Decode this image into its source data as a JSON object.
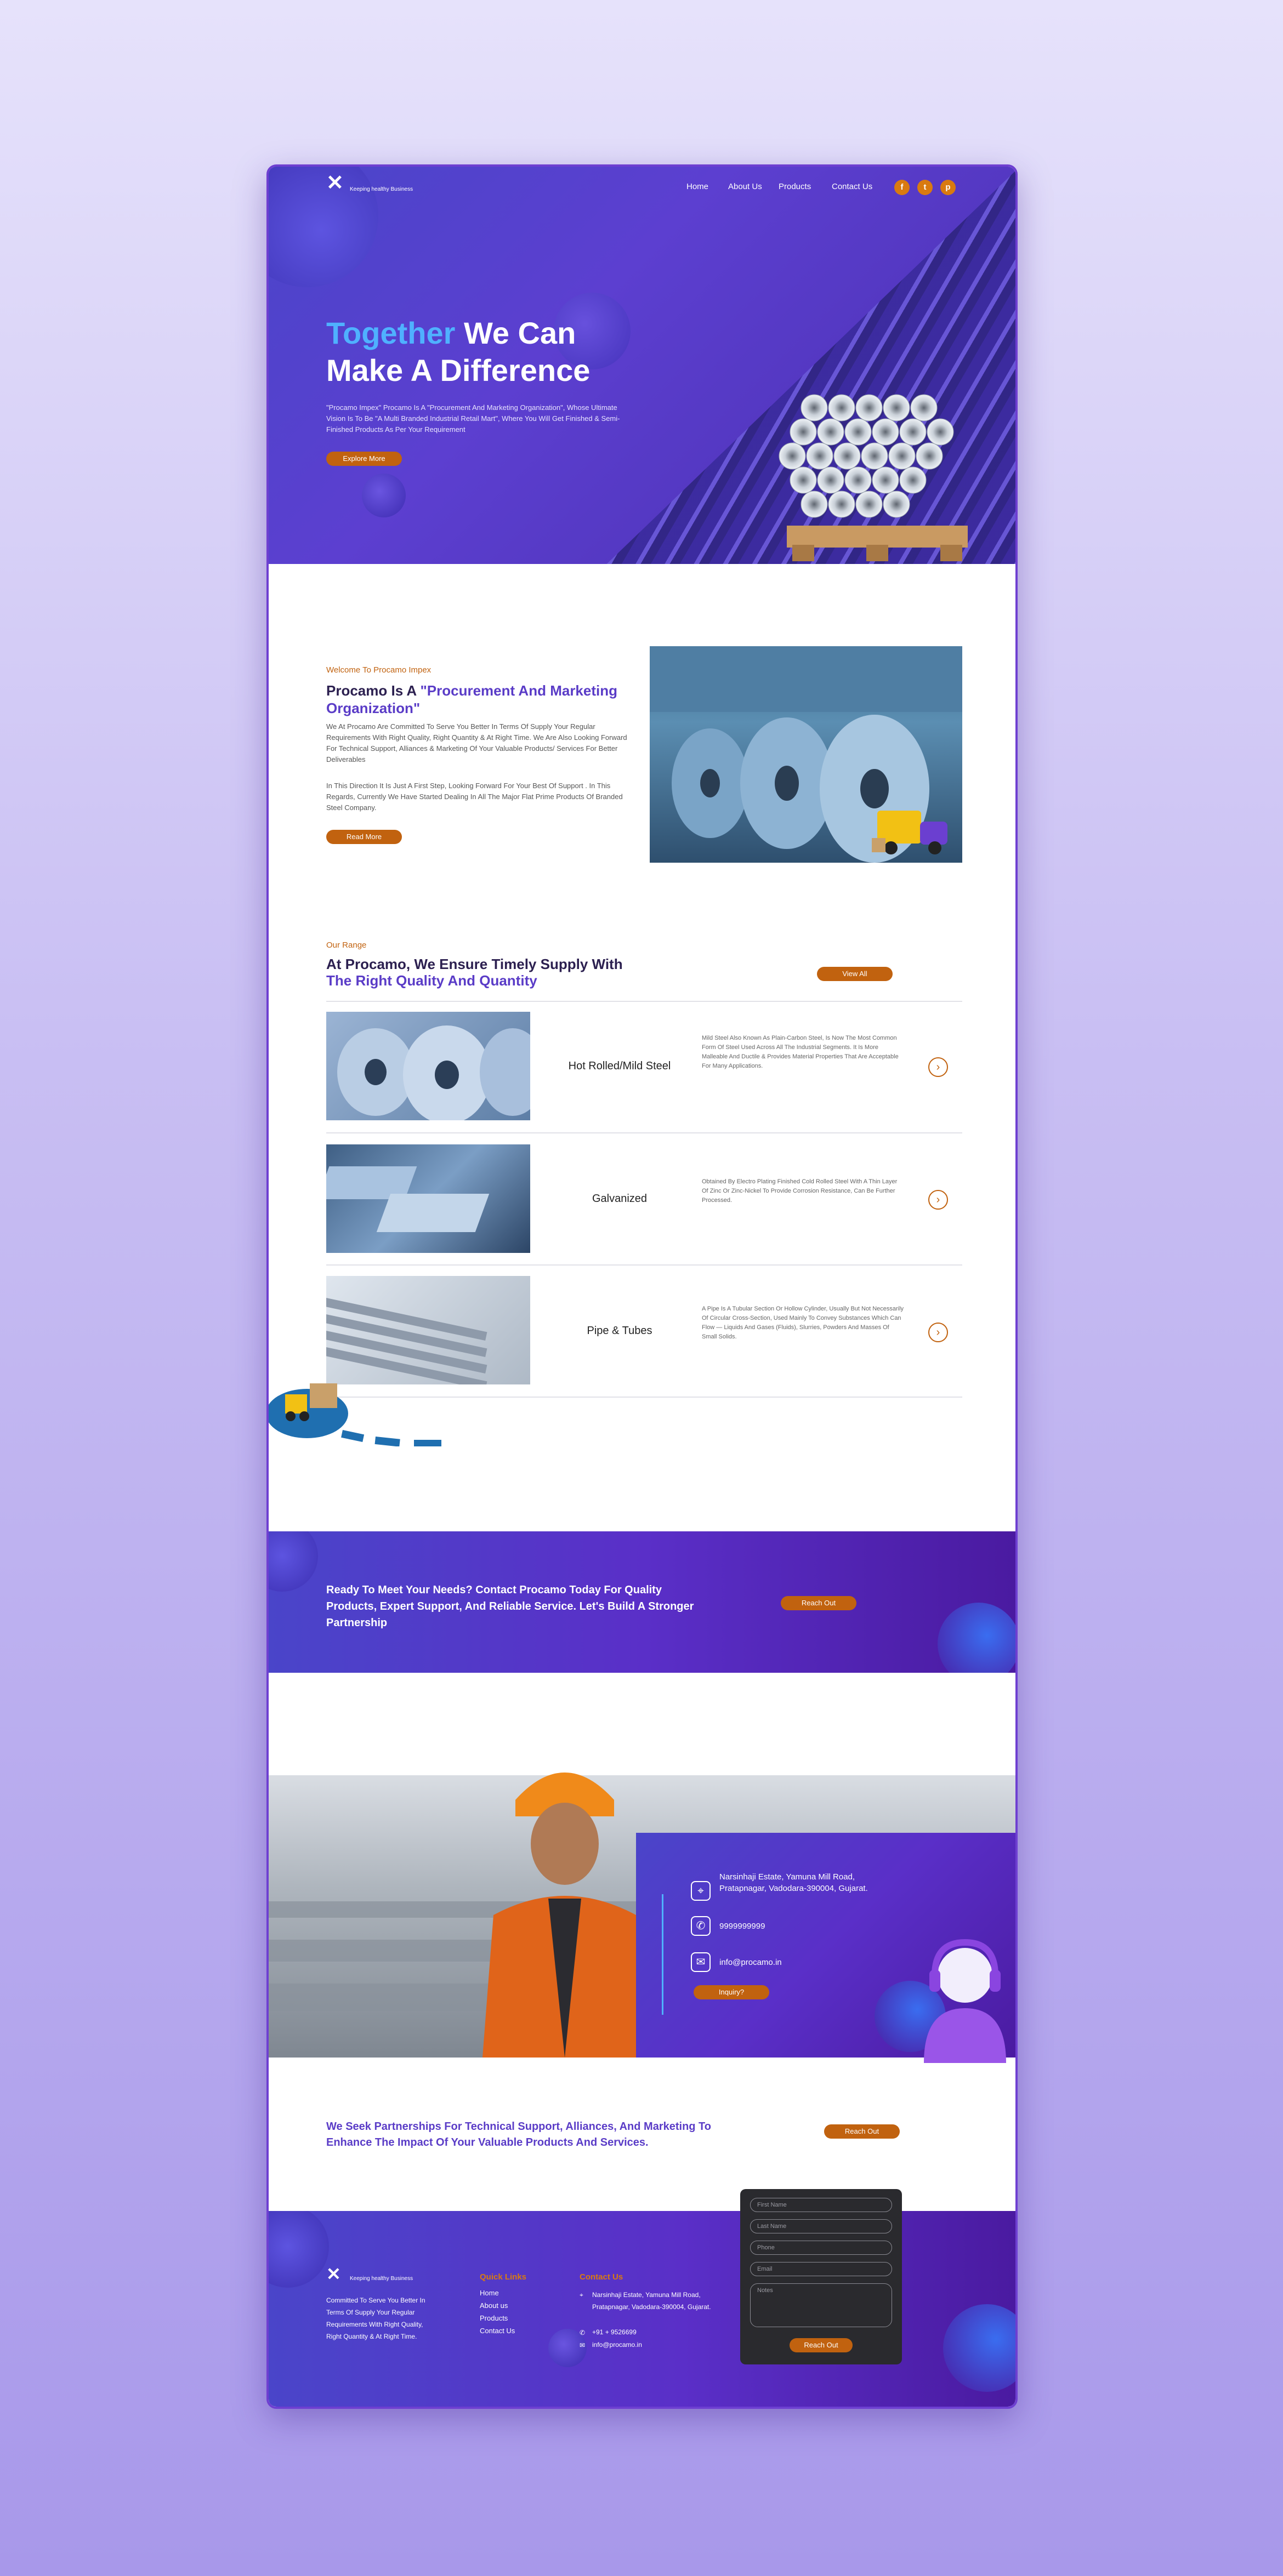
{
  "brand": {
    "tagline": "Keeping healthy Business"
  },
  "nav": {
    "home": "Home",
    "about": "About Us",
    "products": "Products",
    "contact": "Contact Us",
    "social": [
      {
        "icon": "facebook-icon",
        "glyph": "f"
      },
      {
        "icon": "twitter-icon",
        "glyph": "t"
      },
      {
        "icon": "pinterest-icon",
        "glyph": "p"
      }
    ]
  },
  "hero": {
    "title_highlight": "Together",
    "title_rest": " We Can Make A Difference",
    "description": "\"Procamo Impex\" Procamo Is A \"Procurement And Marketing Organization\", Whose Ultimate Vision Is To Be \"A Multi Branded Industrial Retail Mart\", Where You Will Get Finished & Semi- Finished Products As Per Your Requirement",
    "cta": "Explore More"
  },
  "about": {
    "eyebrow": "Welcome To Procamo Impex",
    "title_a": "Procamo Is A ",
    "title_b": "\"Procurement And Marketing Organization\"",
    "p1": "We At Procamo Are Committed To Serve You Better In Terms Of Supply Your Regular Requirements With Right Quality, Right Quantity & At Right Time. We Are Also Looking Forward For Technical Support, Alliances & Marketing Of Your Valuable Products/ Services For Better Deliverables",
    "p2": "In This Direction It Is Just A First Step, Looking Forward For Your Best Of Support . In This Regards, Currently We Have Started Dealing In All The Major Flat Prime Products Of Branded Steel Company.",
    "cta": "Read More"
  },
  "range": {
    "eyebrow": "Our Range",
    "title_a": "At Procamo, We Ensure Timely Supply With ",
    "title_b": "The Right Quality And Quantity",
    "view_all": "View All",
    "products": [
      {
        "name": "Hot Rolled/Mild Steel",
        "desc": "Mild Steel Also Known As Plain-Carbon Steel, Is Now The Most Common Form Of Steel Used Across All The Industrial Segments. It Is More Malleable And Ductile & Provides Material Properties That Are Acceptable For Many Applications."
      },
      {
        "name": "Galvanized",
        "desc": "Obtained By Electro Plating Finished Cold Rolled Steel With A Thin Layer Of Zinc Or Zinc-Nickel To Provide Corrosion Resistance, Can Be Further Processed."
      },
      {
        "name": "Pipe & Tubes",
        "desc": "A Pipe Is A Tubular Section Or Hollow Cylinder, Usually But Not Necessarily Of Circular Cross-Section, Used Mainly To Convey Substances Which Can Flow — Liquids And Gases (Fluids), Slurries, Powders And Masses Of Small Solids."
      }
    ]
  },
  "cta_band": {
    "text": "Ready To Meet Your Needs? Contact Procamo Today For Quality Products, Expert Support, And Reliable Service. Let's Build A Stronger Partnership",
    "button": "Reach Out"
  },
  "contact": {
    "address": "Narsinhaji Estate, Yamuna Mill Road, Pratapnagar, Vadodara-390004, Gujarat.",
    "phone": "9999999999",
    "email": "info@procamo.in",
    "button": "Inquiry?"
  },
  "partner": {
    "text": "We Seek Partnerships For Technical Support, Alliances, And Marketing To Enhance The Impact Of Your Valuable Products And Services.",
    "button": "Reach Out"
  },
  "footer": {
    "about": "Committed To Serve You Better In Terms Of Supply Your Regular Requirements With Right Quality, Right Quantity & At Right Time.",
    "quick_title": "Quick Links",
    "links": [
      "Home",
      "About us",
      "Products",
      "Contact Us"
    ],
    "contact_title": "Contact Us",
    "address": "Narsinhaji Estate, Yamuna Mill Road, Pratapnagar, Vadodara-390004, Gujarat.",
    "phone": "+91 + 9526699",
    "email": "info@procamo.in"
  },
  "form": {
    "first_name": "First Name",
    "last_name": "Last Name",
    "phone": "Phone",
    "email": "Email",
    "notes": "Notes",
    "submit": "Reach Out"
  },
  "colors": {
    "accent": "#c1620f",
    "brand_purple": "#5a3cc7",
    "highlight_blue": "#4fb1ff"
  }
}
